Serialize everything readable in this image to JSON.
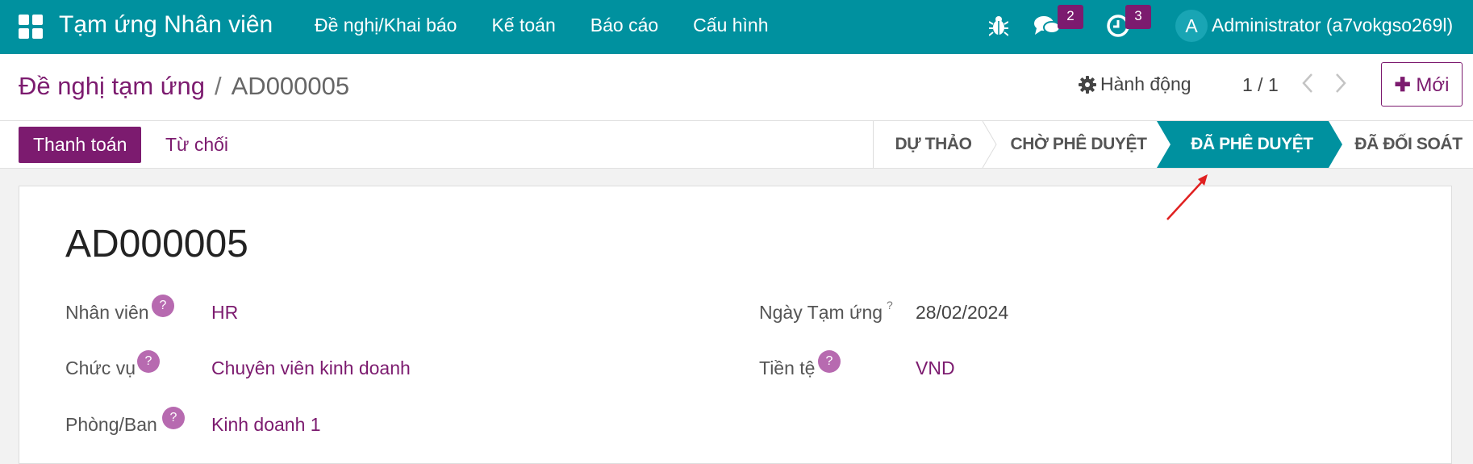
{
  "topbar": {
    "app_title": "Tạm ứng Nhân viên",
    "menu": [
      "Đề nghị/Khai báo",
      "Kế toán",
      "Báo cáo",
      "Cấu hình"
    ],
    "messages_count": "2",
    "activities_count": "3",
    "avatar_letter": "A",
    "user_name": "Administrator (a7vokgso269l)"
  },
  "control_panel": {
    "breadcrumb_parent": "Đề nghị tạm ứng",
    "breadcrumb_separator": "/",
    "breadcrumb_current": "AD000005",
    "action_label": "Hành động",
    "pager_value": "1 / 1",
    "new_label": "Mới"
  },
  "statusbar": {
    "pay_button": "Thanh toán",
    "reject_button": "Từ chối",
    "stages": [
      "DỰ THẢO",
      "CHỜ PHÊ DUYỆT",
      "ĐÃ PHÊ DUYỆT",
      "ĐÃ ĐỐI SOÁT"
    ],
    "active_stage": "ĐÃ PHÊ DUYỆT"
  },
  "form": {
    "record_name": "AD000005",
    "employee_label": "Nhân viên",
    "employee_value": "HR",
    "job_label": "Chức vụ",
    "job_value": "Chuyên viên kinh doanh",
    "department_label": "Phòng/Ban",
    "department_value": "Kinh doanh 1",
    "date_label": "Ngày Tạm ứng",
    "date_value": "28/02/2024",
    "currency_label": "Tiền tệ",
    "currency_value": "VND",
    "help_glyph": "?"
  },
  "colors": {
    "topbar": "#00919f",
    "brand_purple": "#7c1b6f",
    "active_stage": "#00919f",
    "annotation_arrow": "#e02020"
  },
  "icons": [
    "apps-grid-icon",
    "bug-icon",
    "messages-icon",
    "clock-icon",
    "gear-icon",
    "chevron-left-icon",
    "chevron-right-icon",
    "plus-icon"
  ]
}
